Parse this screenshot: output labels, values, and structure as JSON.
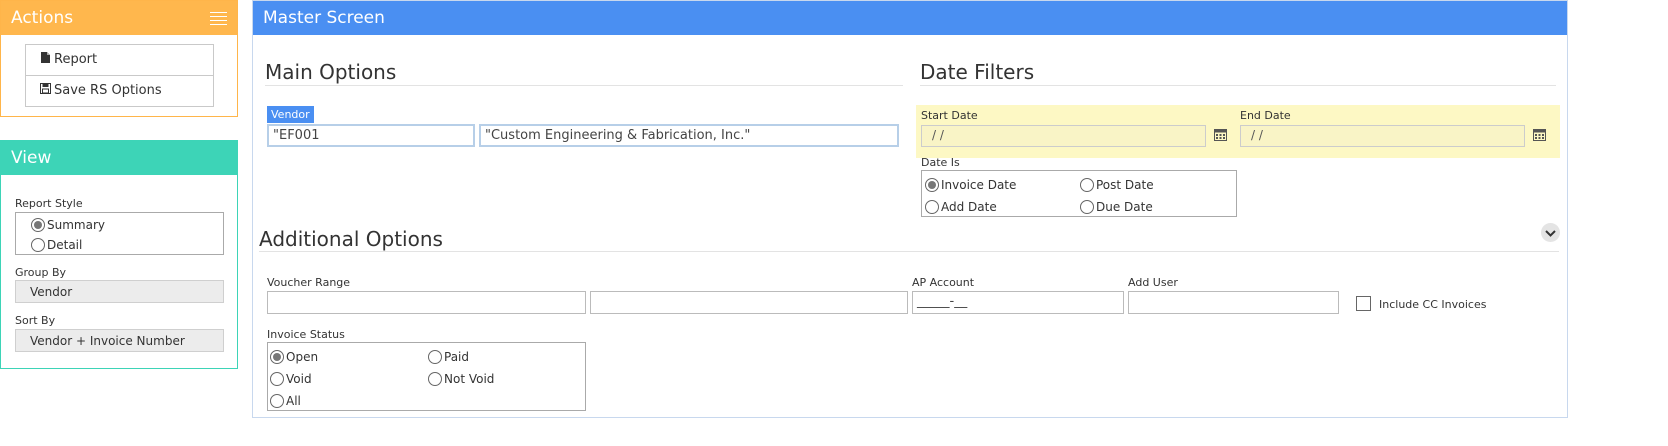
{
  "actions": {
    "title": "Actions",
    "items": [
      {
        "label": "Report",
        "icon": "file-icon"
      },
      {
        "label": "Save RS Options",
        "icon": "floppy-icon"
      }
    ]
  },
  "view": {
    "title": "View",
    "report_style_label": "Report Style",
    "report_style_options": [
      "Summary",
      "Detail"
    ],
    "report_style_selected": "Summary",
    "group_by_label": "Group By",
    "group_by_value": "Vendor",
    "sort_by_label": "Sort By",
    "sort_by_value": "Vendor + Invoice Number"
  },
  "main": {
    "title": "Master Screen",
    "main_options_title": "Main Options",
    "vendor_label": "Vendor",
    "vendor_code": "\"EF001",
    "vendor_name": "\"Custom Engineering & Fabrication, Inc.\"",
    "date_filters_title": "Date Filters",
    "start_date_label": "Start Date",
    "start_date_value": " /  /",
    "end_date_label": "End Date",
    "end_date_value": " /  /",
    "date_is_label": "Date Is",
    "date_is_options": [
      "Invoice Date",
      "Post Date",
      "Add Date",
      "Due Date"
    ],
    "date_is_selected": "Invoice Date",
    "additional_options_title": "Additional Options",
    "voucher_range_label": "Voucher Range",
    "voucher_from": "",
    "voucher_to": "",
    "ap_account_label": "AP Account",
    "ap_account_value": "_____-__",
    "add_user_label": "Add User",
    "add_user_value": "",
    "include_cc_label": "Include CC Invoices",
    "invoice_status_label": "Invoice Status",
    "invoice_status_options": [
      "Open",
      "Paid",
      "Void",
      "Not Void",
      "All"
    ],
    "invoice_status_selected": "Open"
  },
  "colors": {
    "actions_accent": "#ffb74d",
    "view_accent": "#3dd4b7",
    "main_accent": "#4a8ff2",
    "date_bg": "#fdf8c4"
  }
}
